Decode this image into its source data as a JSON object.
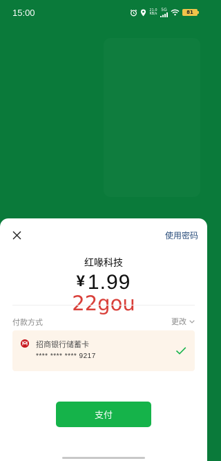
{
  "status_bar": {
    "time": "15:00",
    "net_speed_value": "21.0",
    "net_speed_unit": "KB/s",
    "network_gen": "5G",
    "battery_level": "81",
    "icons": [
      "alarm-icon",
      "location-icon",
      "signal-icon",
      "wifi-icon",
      "battery-icon"
    ]
  },
  "sheet": {
    "use_password_label": "使用密码",
    "merchant_name": "红喙科技",
    "currency_symbol": "¥",
    "amount": "1.99",
    "watermark_text": "22gou",
    "payment_method_label": "付款方式",
    "change_label": "更改",
    "card": {
      "bank_name": "招商银行储蓄卡",
      "masked_number": "**** **** **** 9217",
      "selected": true
    },
    "pay_button_label": "支付"
  },
  "colors": {
    "background_green": "#0a7a3a",
    "pay_button_green": "#15b34a",
    "check_green": "#15b34a",
    "link_blue": "#2c4f7c",
    "watermark_red": "#d9403a",
    "card_bg": "#fdf4ea",
    "bank_red": "#c8161d"
  }
}
